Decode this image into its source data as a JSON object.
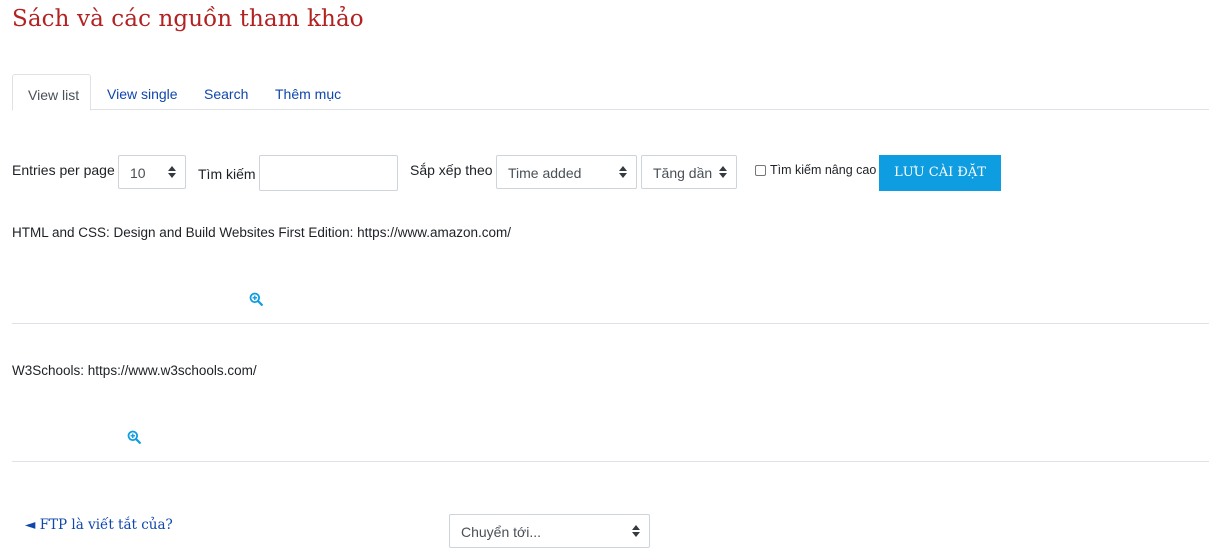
{
  "page": {
    "title": "Sách và các nguồn tham khảo"
  },
  "tabs": [
    {
      "label": "View list",
      "active": true
    },
    {
      "label": "View single"
    },
    {
      "label": "Search"
    },
    {
      "label": "Thêm mục"
    }
  ],
  "controls": {
    "entries_label": "Entries per page",
    "entries_value": "10",
    "search_label": "Tìm kiếm",
    "search_value": "",
    "sort_label": "Sắp xếp theo",
    "sort_field": "Time added",
    "sort_order": "Tăng dần",
    "advanced_label": "Tìm kiếm nâng cao",
    "advanced_checked": false,
    "save_label": "LƯU CÀI ĐẶT"
  },
  "entries": [
    {
      "name": "HTML and CSS: Design and Build Websites First Edition:",
      "url": "https://www.amazon.com/",
      "icon": "zoom-in-icon"
    },
    {
      "name": "W3Schools:",
      "url": "https://www.w3schools.com/",
      "icon": "zoom-in-icon"
    }
  ],
  "footer": {
    "prev_arrow": "◄",
    "prev_link": "FTP là viết tắt của?",
    "jump_label": "Chuyển tới..."
  },
  "colors": {
    "title": "#b22222",
    "link": "#0f47ad",
    "button": "#0e9de0",
    "icon": "#0e9de0"
  }
}
